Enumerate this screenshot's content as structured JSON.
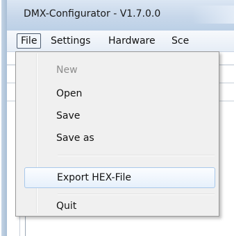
{
  "window": {
    "title": "DMX-Configurator - V1.7.0.0"
  },
  "menubar": {
    "items": [
      {
        "label": "File"
      },
      {
        "label": "Settings"
      },
      {
        "label": "Hardware"
      },
      {
        "label": "Sce"
      }
    ]
  },
  "file_menu": {
    "items": [
      {
        "label": "New",
        "enabled": false
      },
      {
        "label": "Open",
        "enabled": true
      },
      {
        "label": "Save",
        "enabled": true
      },
      {
        "label": "Save as",
        "enabled": true
      },
      {
        "label": "Export HEX-File",
        "enabled": true,
        "highlighted": true
      },
      {
        "label": "Quit",
        "enabled": true
      }
    ]
  },
  "colors": {
    "titlebar": "#c7d7ea",
    "menu_background": "#f0f0f0",
    "highlight_border": "#a8c8ea",
    "disabled_text": "#8d8d8d"
  }
}
